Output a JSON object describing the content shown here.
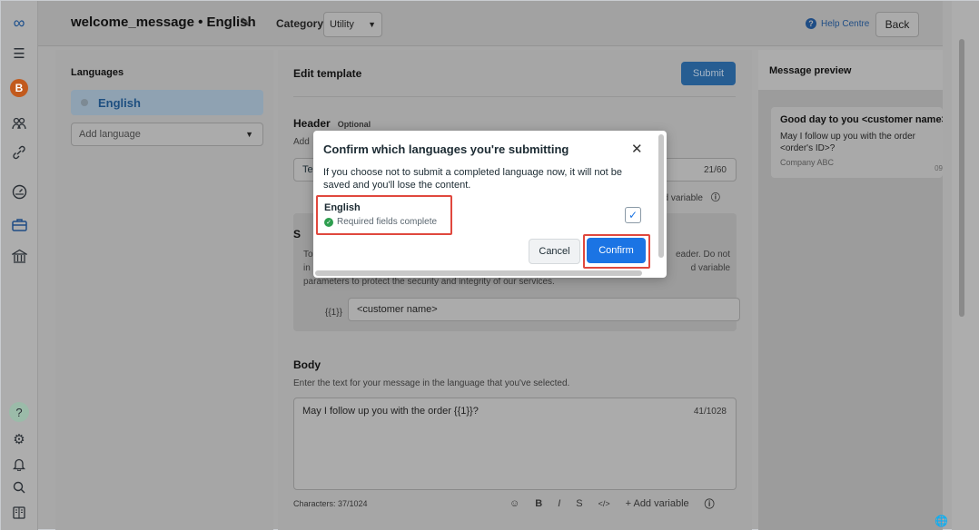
{
  "header": {
    "title": "welcome_message • English",
    "category_label": "Category:",
    "category_value": "Utility",
    "help_label": "Help Centre",
    "back_label": "Back"
  },
  "rail": {
    "avatar_letter": "B",
    "help_symbol": "?"
  },
  "languages_panel": {
    "heading": "Languages",
    "selected_language": "English",
    "add_language_placeholder": "Add language"
  },
  "edit_panel": {
    "heading": "Edit template",
    "submit_label": "Submit",
    "header_section": {
      "heading": "Header",
      "optional": "Optional",
      "add_text": "Add",
      "input_value": "Te",
      "counter": "21/60",
      "add_variable_fragment": "dd variable"
    },
    "samples_section": {
      "heading_fragment": "S",
      "desc_line1_left": "To",
      "desc_line1_right": "eader. Do not",
      "desc_line2_left": "in",
      "desc_line2_right": "d variable",
      "desc_line3": "parameters to protect the security and integrity of our services.",
      "variable_label": "{{1}}",
      "variable_value": "<customer name>"
    },
    "body_section": {
      "heading": "Body",
      "subtitle": "Enter the text for your message in the language that you've selected.",
      "text": "May I follow up you with the order {{1}}?",
      "counter": "41/1028",
      "characters": "Characters: 37/1024",
      "toolbar": {
        "bold": "B",
        "italic": "I",
        "strike": "S",
        "code": "</>",
        "add_variable": "+ Add variable"
      }
    }
  },
  "preview": {
    "heading": "Message preview",
    "greeting": "Good day to you <customer name>",
    "message": "May I follow up you with the order <order's ID>?",
    "company": "Company ABC",
    "time_fragment": "09"
  },
  "modal": {
    "title": "Confirm which languages you're submitting",
    "message": "If you choose not to submit a completed language now, it will not be saved and you'll lose the content.",
    "language_name": "English",
    "language_status": "Required fields complete",
    "language_checked": true,
    "cancel_label": "Cancel",
    "confirm_label": "Confirm"
  },
  "colors": {
    "primary": "#1b74e4",
    "highlight": "#e0483e",
    "success": "#2e9e4f"
  },
  "icons": [
    "meta-logo-icon",
    "menu-icon",
    "people-icon",
    "link-icon",
    "speedometer-icon",
    "briefcase-icon",
    "bank-icon",
    "help-icon",
    "gear-icon",
    "bell-icon",
    "search-icon",
    "book-icon",
    "pencil-icon",
    "chevron-down-icon",
    "close-icon",
    "check-icon",
    "info-icon",
    "emoji-icon",
    "globe-icon"
  ]
}
